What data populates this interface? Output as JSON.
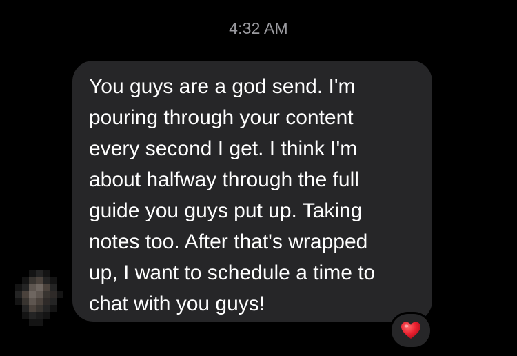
{
  "thread": {
    "timestamp": "4:32 AM"
  },
  "message": {
    "text": "You guys are a god send. I'm\npouring through your content\nevery second I get. I think I'm\nabout halfway through the full\nguide you guys put up. Taking\nnotes too. After that's wrapped\nup, I want to schedule a time to\nchat with you guys!",
    "reaction_icon": "red-heart-icon",
    "bubble_color": "#262628",
    "text_color": "#ffffff"
  },
  "sender": {
    "avatar_icon": "pixelated-avatar-icon"
  }
}
